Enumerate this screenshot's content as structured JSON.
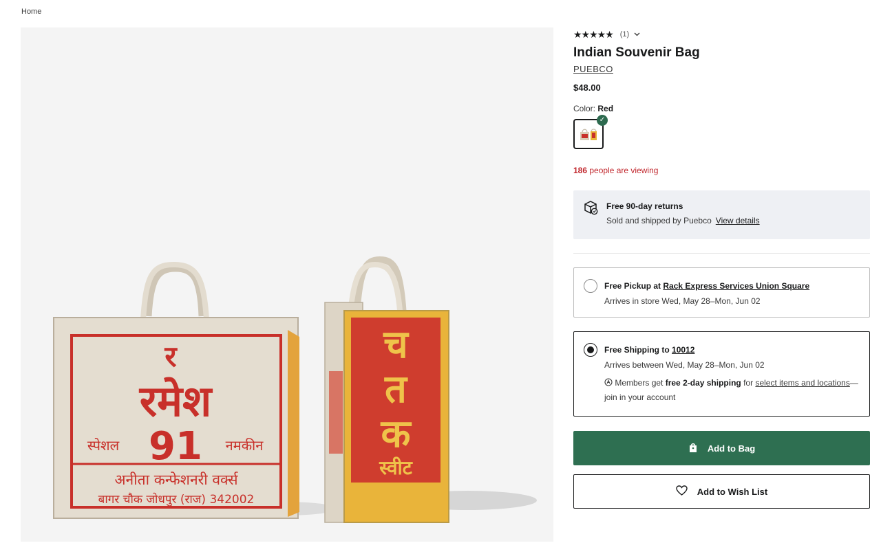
{
  "breadcrumb": {
    "home": "Home"
  },
  "product": {
    "stars": "★★★★★",
    "rating_count": "(1)",
    "title": "Indian Souvenir Bag",
    "brand": "PUEBCO",
    "price": "$48.00",
    "color_label": "Color:",
    "color_value": "Red",
    "viewing_count": "186",
    "viewing_text": "people are viewing"
  },
  "returns": {
    "title": "Free 90-day returns",
    "sold_by": "Sold and shipped by Puebco",
    "details_link": "View details"
  },
  "pickup": {
    "prefix": "Free Pickup at",
    "store": "Rack Express Services Union Square",
    "arrives": "Arrives in store Wed, May 28–Mon, Jun 02"
  },
  "shipping": {
    "prefix": "Free Shipping to",
    "zip": "10012",
    "arrives": "Arrives between Wed, May 28–Mon, Jun 02",
    "members_prefix": "Members get",
    "members_bold": "free 2-day shipping",
    "members_mid": "for",
    "members_link": "select items and locations",
    "members_suffix": "—join in your account"
  },
  "actions": {
    "add_to_bag": "Add to Bag",
    "add_to_wishlist": "Add to Wish List"
  },
  "bag_print": {
    "left_big": "रमेश",
    "left_char": "र",
    "left_num": "91",
    "left_small_a": "स्पेशल",
    "left_small_b": "नमकीन",
    "left_line1": "अनीता कन्फेशनरी वर्क्स",
    "left_line2": "बागर चौक जोधपुर (राज) 342002",
    "right_a": "च",
    "right_b": "त",
    "right_c": "क",
    "right_foot": "स्वीट"
  },
  "colors": {
    "accent_green": "#2e6f51",
    "alert_red": "#c1272d",
    "returns_bg": "#eef0f4"
  }
}
